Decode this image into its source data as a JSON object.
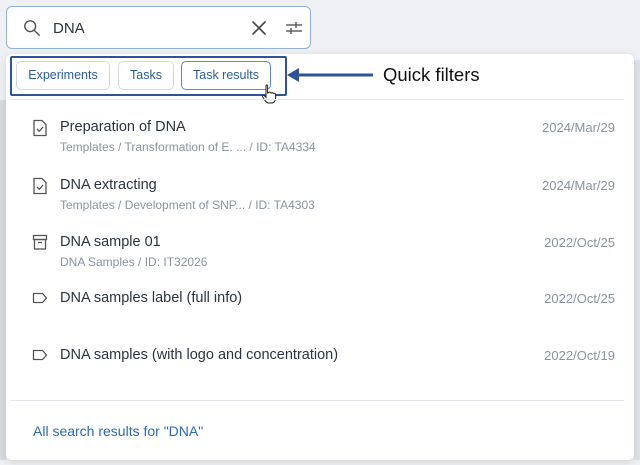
{
  "search": {
    "value": "DNA",
    "icons": {
      "search": "search-icon",
      "clear": "close-icon",
      "filter": "sliders-icon"
    }
  },
  "quick_filters": {
    "annotation": "Quick filters",
    "chips": [
      {
        "label": "Experiments"
      },
      {
        "label": "Tasks"
      },
      {
        "label": "Task results"
      }
    ]
  },
  "results": [
    {
      "title": "Preparation of DNA",
      "subtitle": "Templates / Transformation of E. ...  / ID: TA4334",
      "date": "2024/Mar/29",
      "icon": "task-check-icon"
    },
    {
      "title": "DNA extracting",
      "subtitle": "Templates / Development of SNP...  / ID: TA4303",
      "date": "2024/Mar/29",
      "icon": "task-check-icon"
    },
    {
      "title": "DNA sample 01",
      "subtitle": "DNA Samples / ID: IT32026",
      "date": "2022/Oct/25",
      "icon": "archive-box-icon"
    },
    {
      "title": "DNA samples label (full info)",
      "subtitle": "",
      "date": "2022/Oct/25",
      "icon": "tag-icon"
    },
    {
      "title": "DNA samples (with logo and concentration)",
      "subtitle": "",
      "date": "2022/Oct/19",
      "icon": "tag-icon"
    }
  ],
  "footer": {
    "all_results": "All search results for \"DNA\""
  },
  "colors": {
    "accent": "#2c6bb3",
    "annotation_outline": "#2f5597"
  }
}
